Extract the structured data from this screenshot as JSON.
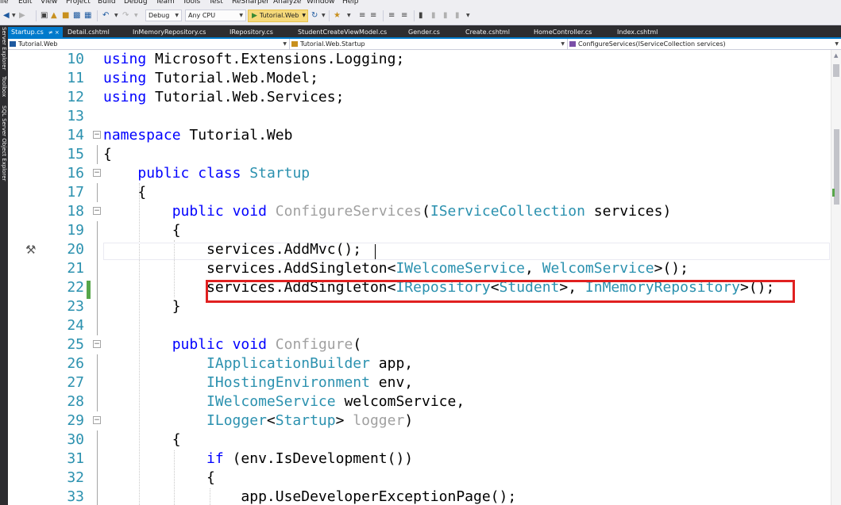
{
  "menu": [
    "ile",
    "Edit",
    "View",
    "Project",
    "Build",
    "Debug",
    "Team",
    "Tools",
    "Test",
    "ReSharper",
    "Analyze",
    "Window",
    "Help"
  ],
  "toolbar": {
    "configuration": "Debug",
    "platform": "Any CPU",
    "run_target": "Tutorial.Web"
  },
  "side_tools": [
    "Server Explorer",
    "Toolbox",
    "SQL Server Object Explorer"
  ],
  "tabs": [
    {
      "label": "Startup.cs",
      "active": true
    },
    {
      "label": "Detail.cshtml"
    },
    {
      "label": "InMemoryRepository.cs"
    },
    {
      "label": "IRepository.cs"
    },
    {
      "label": "StudentCreateViewModel.cs"
    },
    {
      "label": "Gender.cs"
    },
    {
      "label": "Create.cshtml"
    },
    {
      "label": "HomeController.cs"
    },
    {
      "label": "Index.cshtml"
    }
  ],
  "tab_buttons": "≠ ×",
  "navigation": {
    "project": "Tutorial.Web",
    "type": "Tutorial.Web.Startup",
    "member": "ConfigureServices(IServiceCollection services)"
  },
  "editor": {
    "current_line": 20,
    "changed_line": 22,
    "lines": [
      {
        "n": "10",
        "tokens": [
          [
            "kw",
            "using"
          ],
          [
            "pl",
            " Microsoft.Extensions.Logging;"
          ]
        ]
      },
      {
        "n": "11",
        "tokens": [
          [
            "kw",
            "using"
          ],
          [
            "pl",
            " Tutorial.Web.Model;"
          ]
        ]
      },
      {
        "n": "12",
        "tokens": [
          [
            "kw",
            "using"
          ],
          [
            "pl",
            " Tutorial.Web.Services;"
          ]
        ]
      },
      {
        "n": "13",
        "tokens": []
      },
      {
        "n": "14",
        "tokens": [
          [
            "kw",
            "namespace"
          ],
          [
            "pl",
            " Tutorial.Web"
          ]
        ]
      },
      {
        "n": "15",
        "tokens": [
          [
            "pl",
            "{"
          ]
        ]
      },
      {
        "n": "16",
        "tokens": [
          [
            "pl",
            "    "
          ],
          [
            "kw",
            "public"
          ],
          [
            "pl",
            " "
          ],
          [
            "kw",
            "class"
          ],
          [
            "pl",
            " "
          ],
          [
            "ty",
            "Startup"
          ]
        ]
      },
      {
        "n": "17",
        "tokens": [
          [
            "pl",
            "    {"
          ]
        ]
      },
      {
        "n": "18",
        "tokens": [
          [
            "pl",
            "        "
          ],
          [
            "kw",
            "public"
          ],
          [
            "pl",
            " "
          ],
          [
            "kw",
            "void"
          ],
          [
            "pl",
            " "
          ],
          [
            "mt",
            "ConfigureServices"
          ],
          [
            "pl",
            "("
          ],
          [
            "ty",
            "IServiceCollection"
          ],
          [
            "pl",
            " services)"
          ]
        ]
      },
      {
        "n": "19",
        "tokens": [
          [
            "pl",
            "        {"
          ]
        ]
      },
      {
        "n": "20",
        "tokens": [
          [
            "pl",
            "            services.AddMvc();"
          ]
        ]
      },
      {
        "n": "21",
        "tokens": [
          [
            "pl",
            "            services.AddSingleton<"
          ],
          [
            "ty",
            "IWelcomeService"
          ],
          [
            "pl",
            ", "
          ],
          [
            "ty",
            "WelcomService"
          ],
          [
            "pl",
            ">();"
          ]
        ]
      },
      {
        "n": "22",
        "tokens": [
          [
            "pl",
            "            services.AddSingleton<"
          ],
          [
            "ty",
            "IRepository"
          ],
          [
            "pl",
            "<"
          ],
          [
            "ty",
            "Student"
          ],
          [
            "pl",
            ">, "
          ],
          [
            "ty",
            "InMemoryRepository"
          ],
          [
            "pl",
            ">();"
          ]
        ]
      },
      {
        "n": "23",
        "tokens": [
          [
            "pl",
            "        }"
          ]
        ]
      },
      {
        "n": "24",
        "tokens": []
      },
      {
        "n": "25",
        "tokens": [
          [
            "pl",
            "        "
          ],
          [
            "kw",
            "public"
          ],
          [
            "pl",
            " "
          ],
          [
            "kw",
            "void"
          ],
          [
            "pl",
            " "
          ],
          [
            "mt",
            "Configure"
          ],
          [
            "pl",
            "("
          ]
        ]
      },
      {
        "n": "26",
        "tokens": [
          [
            "pl",
            "            "
          ],
          [
            "ty",
            "IApplicationBuilder"
          ],
          [
            "pl",
            " app,"
          ]
        ]
      },
      {
        "n": "27",
        "tokens": [
          [
            "pl",
            "            "
          ],
          [
            "ty",
            "IHostingEnvironment"
          ],
          [
            "pl",
            " env,"
          ]
        ]
      },
      {
        "n": "28",
        "tokens": [
          [
            "pl",
            "            "
          ],
          [
            "ty",
            "IWelcomeService"
          ],
          [
            "pl",
            " welcomService,"
          ]
        ]
      },
      {
        "n": "29",
        "tokens": [
          [
            "pl",
            "            "
          ],
          [
            "ty",
            "ILogger"
          ],
          [
            "pl",
            "<"
          ],
          [
            "ty",
            "Startup"
          ],
          [
            "pl",
            "> "
          ],
          [
            "gp",
            "logger"
          ],
          [
            "pl",
            ")"
          ]
        ]
      },
      {
        "n": "30",
        "tokens": [
          [
            "pl",
            "        {"
          ]
        ]
      },
      {
        "n": "31",
        "tokens": [
          [
            "pl",
            "            "
          ],
          [
            "kw",
            "if"
          ],
          [
            "pl",
            " (env.IsDevelopment())"
          ]
        ]
      },
      {
        "n": "32",
        "tokens": [
          [
            "pl",
            "            {"
          ]
        ]
      },
      {
        "n": "33",
        "tokens": [
          [
            "pl",
            "                app.UseDeveloperExceptionPage();"
          ]
        ]
      }
    ]
  },
  "colors": {
    "keyword": "#0000ff",
    "type": "#2b91af",
    "line_number": "#2b91af",
    "annotation_box": "#e02020",
    "change_bar": "#57a64a",
    "tab_accent": "#007acc"
  }
}
